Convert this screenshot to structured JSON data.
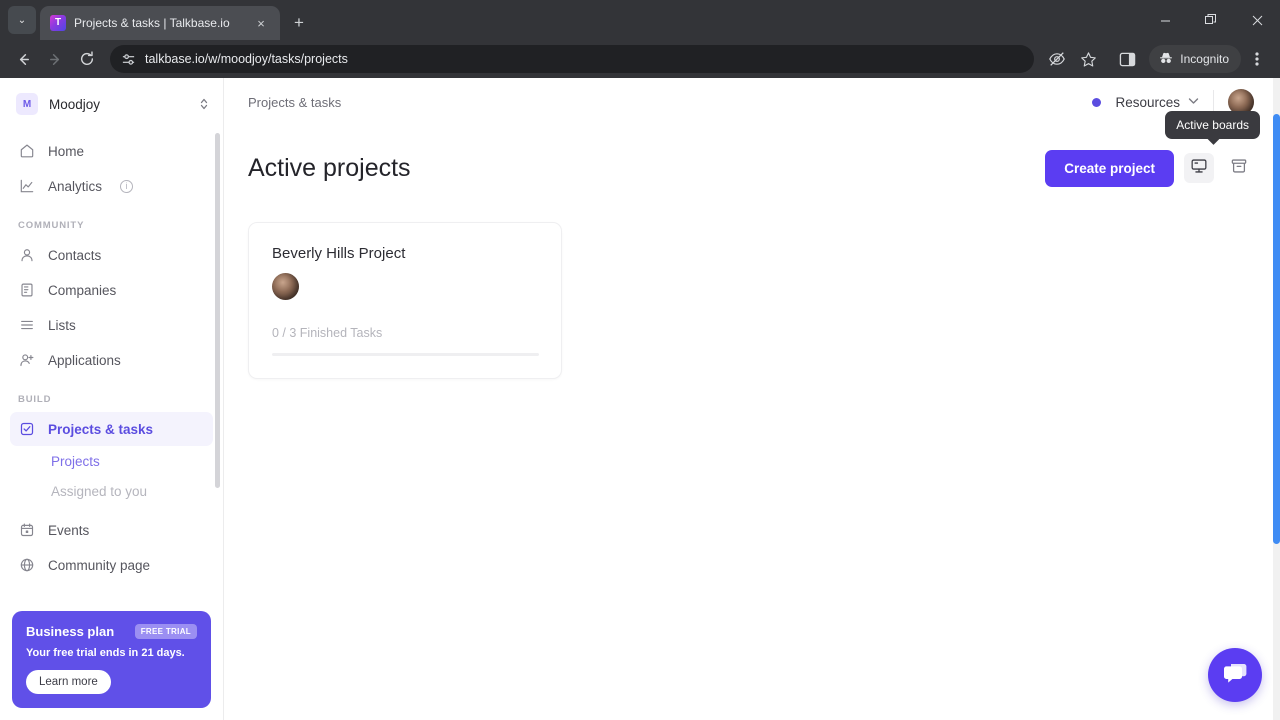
{
  "browser": {
    "tab": {
      "title": "Projects & tasks | Talkbase.io",
      "favicon": "talkbase-logo-icon",
      "close_label": "×"
    },
    "tab_list_label": "⌄",
    "new_tab_label": "+",
    "nav": {
      "back": "←",
      "forward": "→",
      "reload": "⟳"
    },
    "omnibox": {
      "url": "talkbase.io/w/moodjoy/tasks/projects",
      "site_settings_icon": "tune-icon"
    },
    "toolbar_right": {
      "tracking_protection_icon": "eye-off-icon",
      "bookmark_icon": "star-icon",
      "side_panel_icon": "side-panel-icon",
      "incognito_label": "Incognito",
      "incognito_icon": "incognito-hat-icon",
      "menu_icon": "three-dot-menu-icon"
    },
    "window": {
      "minimize": "─",
      "maximize": "❐",
      "close": "✕"
    }
  },
  "sidebar": {
    "workspace": {
      "badge": "M",
      "name": "Moodjoy",
      "switch_icon": "chevron-updown-icon"
    },
    "items": [
      {
        "label": "Home",
        "icon": "home-icon",
        "name": "home",
        "active": false
      },
      {
        "label": "Analytics",
        "icon": "chart-line-icon",
        "name": "analytics",
        "active": false,
        "info": "i"
      }
    ],
    "sections": [
      {
        "label": "COMMUNITY",
        "items": [
          {
            "label": "Contacts",
            "icon": "person-icon",
            "name": "contacts"
          },
          {
            "label": "Companies",
            "icon": "building-icon",
            "name": "companies"
          },
          {
            "label": "Lists",
            "icon": "list-icon",
            "name": "lists"
          },
          {
            "label": "Applications",
            "icon": "person-plus-icon",
            "name": "applications"
          }
        ]
      },
      {
        "label": "BUILD",
        "items": [
          {
            "label": "Projects & tasks",
            "icon": "checkbox-icon",
            "name": "projects-tasks",
            "active": true
          },
          {
            "label": "Events",
            "icon": "calendar-icon",
            "name": "events"
          },
          {
            "label": "Community page",
            "icon": "globe-icon",
            "name": "community-page"
          }
        ],
        "subitems": [
          {
            "label": "Projects",
            "name": "projects",
            "active": true
          },
          {
            "label": "Assigned to you",
            "name": "assigned-to-you",
            "active": false
          }
        ]
      }
    ],
    "plan": {
      "title": "Business plan",
      "badge": "FREE TRIAL",
      "subtitle": "Your free trial ends in 21 days.",
      "button": "Learn more"
    }
  },
  "topbar": {
    "breadcrumb": "Projects & tasks",
    "status_dot_color": "#5b4de0",
    "resources_label": "Resources",
    "resources_chevron": "⌄",
    "avatar_name": "user-avatar"
  },
  "page": {
    "title": "Active projects",
    "create_button": "Create project",
    "tooltip": "Active boards",
    "view_buttons": [
      {
        "name": "active-boards",
        "icon": "board-icon",
        "active": true
      },
      {
        "name": "archived-boards",
        "icon": "archive-icon",
        "active": false
      }
    ]
  },
  "projects": [
    {
      "title": "Beverly Hills Project",
      "members": 1,
      "tasks_label": "0 / 3 Finished Tasks",
      "finished": 0,
      "total": 3,
      "progress_percent": 0
    }
  ],
  "chat": {
    "icon": "chat-bubble-icon",
    "color": "#5b3df2"
  },
  "colors": {
    "accent": "#5b3df2",
    "sidebar_active_text": "#5b4de0",
    "sidebar_active_bg": "#f4f3fd",
    "plan_bg": "#6050e8",
    "tooltip_bg": "#3a3a3f",
    "scrollbar_thumb": "#3f8cf4"
  }
}
